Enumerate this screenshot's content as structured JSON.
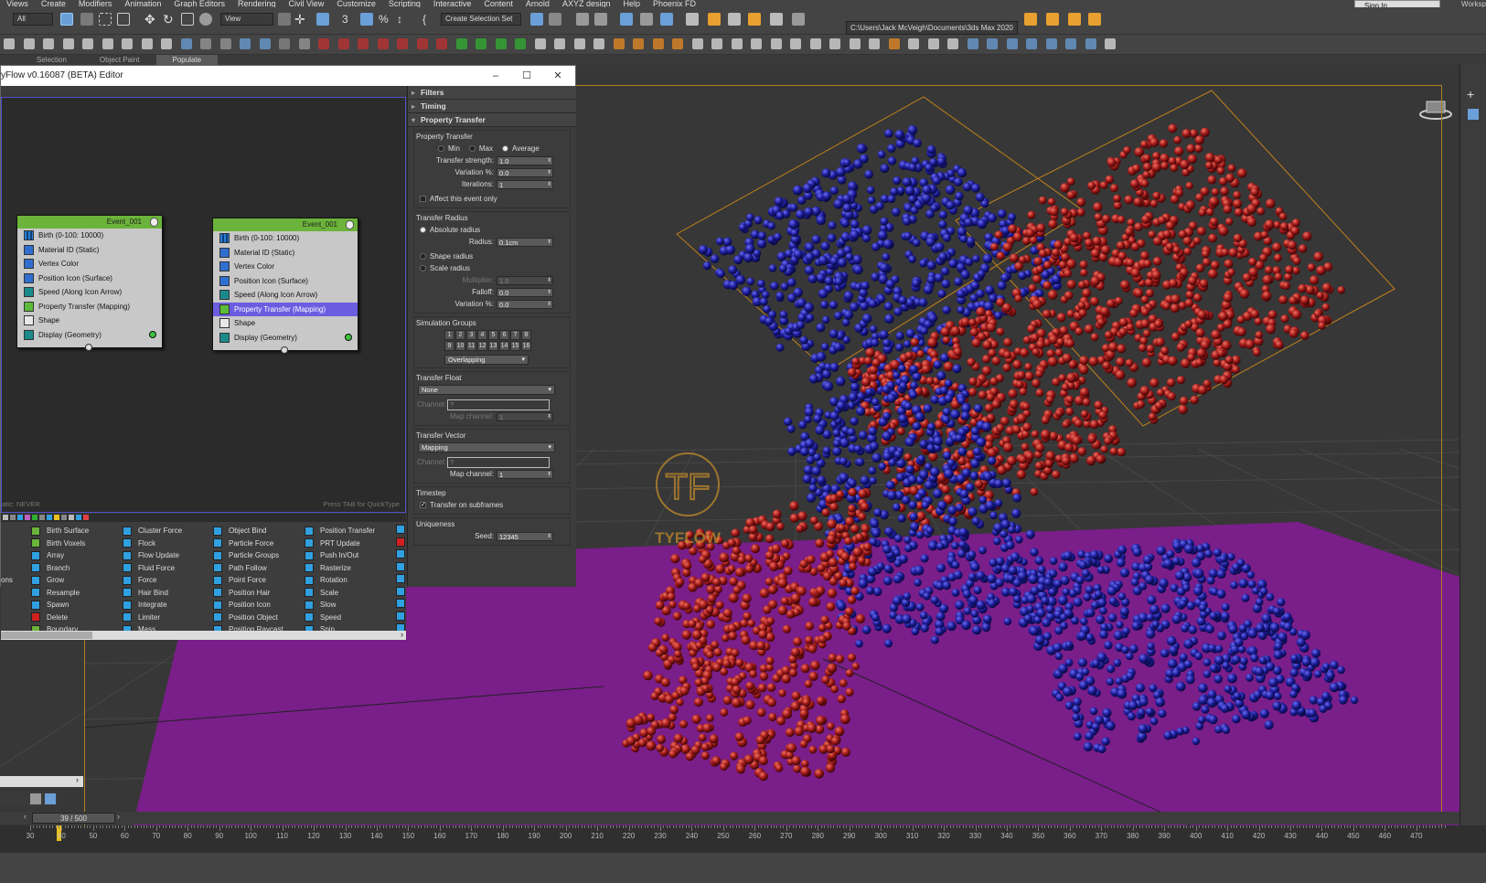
{
  "menubar": {
    "items": [
      "Views",
      "Create",
      "Modifiers",
      "Animation",
      "Graph Editors",
      "Rendering",
      "Civil View",
      "Customize",
      "Scripting",
      "Interactive",
      "Content",
      "Arnold",
      "AXYZ design",
      "Help",
      "Phoenix FD"
    ],
    "sign_in": "Sign In",
    "workspaces": "Worksp"
  },
  "toolbar": {
    "filter": "All",
    "view": "View",
    "selection_set": "Create Selection Set",
    "project_path": "C:\\Users\\Jack McVeigh\\Documents\\3ds Max 2020"
  },
  "ribbon": {
    "tabs": [
      "Selection",
      "Object Paint",
      "Populate"
    ]
  },
  "editor": {
    "title": "yFlow v0.16087 (BETA) Editor",
    "quick_hint": "Press TAB for QuickType",
    "static_hint": "atic: NEVER",
    "events": [
      {
        "name": "Event_001",
        "operators": [
          "Birth (0-100: 10000)",
          "Material ID (Static)",
          "Vertex Color",
          "Position Icon (Surface)",
          "Speed (Along Icon Arrow)",
          "Property Transfer (Mapping)",
          "Shape",
          "Display (Geometry)"
        ]
      },
      {
        "name": "Event_001",
        "operators": [
          "Birth (0-100: 10000)",
          "Material ID (Static)",
          "Vertex Color",
          "Position Icon (Surface)",
          "Speed (Along Icon Arrow)",
          "Property Transfer (Mapping)",
          "Shape",
          "Display (Geometry)"
        ]
      }
    ],
    "depot": {
      "col0": [
        "",
        "",
        "",
        "",
        "ons",
        "",
        "",
        "",
        ""
      ],
      "col1": [
        "Birth Surface",
        "Birth Voxels",
        "Array",
        "Branch",
        "Grow",
        "Resample",
        "Spawn",
        "Delete",
        "Boundary"
      ],
      "col2": [
        "Cluster Force",
        "Flock",
        "Flow Update",
        "Fluid Force",
        "Force",
        "Hair Bind",
        "Integrate",
        "Limiter",
        "Mass"
      ],
      "col3": [
        "Object Bind",
        "Particle Force",
        "Particle Groups",
        "Path Follow",
        "Point Force",
        "Position Hair",
        "Position Icon",
        "Position Object",
        "Position Raycast"
      ],
      "col4": [
        "Position Transfer",
        "PRT Update",
        "Push In/Out",
        "Rasterize",
        "Rotation",
        "Scale",
        "Slow",
        "Speed",
        "Spin"
      ]
    }
  },
  "props": {
    "filters": "Filters",
    "timing": "Timing",
    "property_transfer": "Property Transfer",
    "pt_group": "Property Transfer",
    "modes": [
      "Min",
      "Max",
      "Average"
    ],
    "transfer_strength_label": "Transfer strength:",
    "transfer_strength": "1.0",
    "variation_label": "Variation %:",
    "variation": "0.0",
    "iterations_label": "Iterations:",
    "iterations": "1",
    "affect_event": "Affect this event only",
    "radius_group": "Transfer Radius",
    "absolute_radius": "Absolute radius",
    "radius_label": "Radius:",
    "radius": "0.1cm",
    "shape_radius": "Shape radius",
    "scale_radius": "Scale radius",
    "multiplier_label": "Multiplier:",
    "multiplier": "1.0",
    "falloff_label": "Falloff:",
    "falloff": "0.0",
    "variation2_label": "Variation %:",
    "variation2": "0.0",
    "sim_groups": "Simulation Groups",
    "group_numbers": [
      "1",
      "2",
      "3",
      "4",
      "5",
      "6",
      "7",
      "8",
      "9",
      "10",
      "11",
      "12",
      "13",
      "14",
      "15",
      "16"
    ],
    "overlapping": "Overlapping",
    "transfer_float": "Transfer Float",
    "float_value": "None",
    "channel_label": "Channel:",
    "channel_placeholder": "?",
    "map_channel_label": "Map channel:",
    "map_channel_float": "1",
    "transfer_vector": "Transfer Vector",
    "vector_value": "Mapping",
    "map_channel_vector": "1",
    "timestep": "Timestep",
    "subframes": "Transfer on subframes",
    "uniqueness": "Uniqueness",
    "seed_label": "Seed:",
    "seed": "12345"
  },
  "timeline": {
    "frame": "39 / 500",
    "ticks": [
      "30",
      "40",
      "50",
      "60",
      "70",
      "80",
      "90",
      "100",
      "110",
      "120",
      "130",
      "140",
      "150",
      "160",
      "170",
      "180",
      "190",
      "200",
      "210",
      "220",
      "230",
      "240",
      "250",
      "260",
      "270",
      "280",
      "290",
      "300",
      "310",
      "320",
      "330",
      "340",
      "350",
      "360",
      "370",
      "380",
      "390",
      "400",
      "410",
      "420",
      "430",
      "440",
      "450",
      "460",
      "470"
    ]
  },
  "logo": {
    "text": "TYFLOW"
  },
  "colors": {
    "ground": "#7a1e8a",
    "blue_particles": "#1c1c9a",
    "red_particles": "#a01818",
    "selection": "#6a5de0"
  }
}
